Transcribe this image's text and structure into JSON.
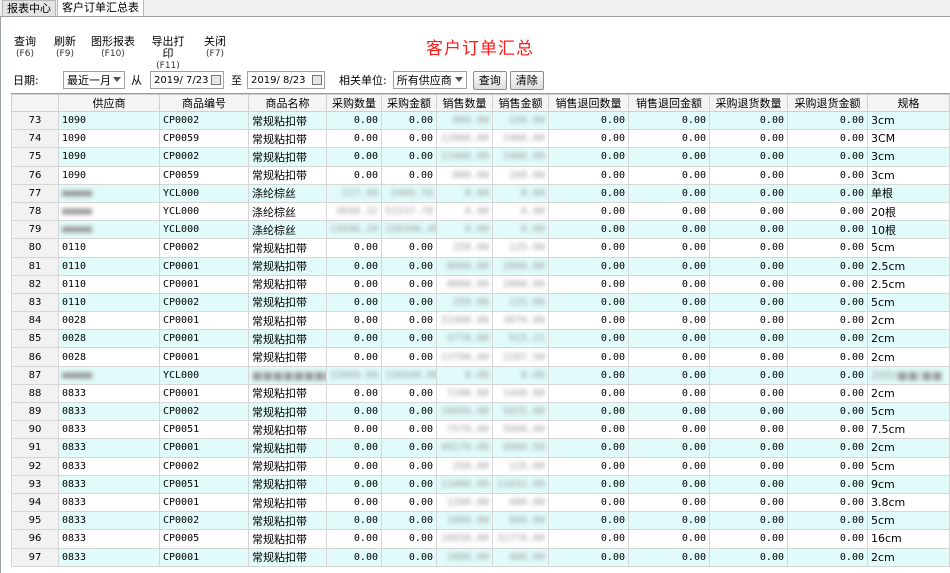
{
  "tabs": [
    {
      "label": "报表中心",
      "active": false
    },
    {
      "label": "客户订单汇总表",
      "active": true
    }
  ],
  "toolbar": {
    "buttons": [
      {
        "label": "查询",
        "key": "(F6)"
      },
      {
        "label": "刷新",
        "key": "(F9)"
      },
      {
        "label": "图形报表",
        "key": "(F10)"
      },
      {
        "label": "导出打印",
        "key": "(F11)"
      },
      {
        "label": "关闭",
        "key": "(F7)"
      }
    ]
  },
  "page_title": "客户订单汇总",
  "filters": {
    "date_label": "日期:",
    "period_value": "最近一月",
    "from_label": "从",
    "date_from": "2019/ 7/23",
    "to_label": "至",
    "date_to": "2019/ 8/23",
    "unit_label": "相关单位:",
    "unit_value": "所有供应商",
    "query_button": "查询",
    "clear_button": "清除"
  },
  "table": {
    "columns": [
      "",
      "供应商",
      "商品编号",
      "商品名称",
      "采购数量",
      "采购金额",
      "销售数量",
      "销售金额",
      "销售退回数量",
      "销售退回金额",
      "采购退货数量",
      "采购退货金额",
      "规格"
    ],
    "rows": [
      [
        "73",
        "1090",
        "CP0002",
        "常规粘扣带",
        "0.00",
        "0.00",
        "800.00",
        "160.00",
        "0.00",
        "0.00",
        "0.00",
        "0.00",
        "3cm"
      ],
      [
        "74",
        "1090",
        "CP0059",
        "常规粘扣带",
        "0.00",
        "0.00",
        "12000.00",
        "2400.00",
        "0.00",
        "0.00",
        "0.00",
        "0.00",
        "3CM"
      ],
      [
        "75",
        "1090",
        "CP0002",
        "常规粘扣带",
        "0.00",
        "0.00",
        "12400.00",
        "2400.00",
        "0.00",
        "0.00",
        "0.00",
        "0.00",
        "3cm"
      ],
      [
        "76",
        "1090",
        "CP0059",
        "常规粘扣带",
        "0.00",
        "0.00",
        "800.00",
        "160.00",
        "0.00",
        "0.00",
        "0.00",
        "0.00",
        "3cm"
      ],
      [
        "77",
        "■■■■■",
        "YCL000",
        "涤纶棕丝",
        "217.40",
        "2409.70",
        "0.00",
        "0.00",
        "0.00",
        "0.00",
        "0.00",
        "0.00",
        "单根"
      ],
      [
        "78",
        "■■■■■",
        "YCL000",
        "涤纶棕丝",
        "4650.32",
        "51537.78",
        "0.00",
        "0.00",
        "0.00",
        "0.00",
        "0.00",
        "0.00",
        "20根"
      ],
      [
        "79",
        "■■■■■",
        "YCL000",
        "涤纶棕丝",
        "13596.20",
        "150396.49",
        "0.00",
        "0.00",
        "0.00",
        "0.00",
        "0.00",
        "0.00",
        "10根"
      ],
      [
        "80",
        "0110",
        "CP0002",
        "常规粘扣带",
        "0.00",
        "0.00",
        "250.00",
        "125.00",
        "0.00",
        "0.00",
        "0.00",
        "0.00",
        "5cm"
      ],
      [
        "81",
        "0110",
        "CP0001",
        "常规粘扣带",
        "0.00",
        "0.00",
        "8000.00",
        "2000.00",
        "0.00",
        "0.00",
        "0.00",
        "0.00",
        "2.5cm"
      ],
      [
        "82",
        "0110",
        "CP0001",
        "常规粘扣带",
        "0.00",
        "0.00",
        "8000.00",
        "2000.00",
        "0.00",
        "0.00",
        "0.00",
        "0.00",
        "2.5cm"
      ],
      [
        "83",
        "0110",
        "CP0002",
        "常规粘扣带",
        "0.00",
        "0.00",
        "250.00",
        "125.00",
        "0.00",
        "0.00",
        "0.00",
        "0.00",
        "5cm"
      ],
      [
        "84",
        "0028",
        "CP0001",
        "常规粘扣带",
        "0.00",
        "0.00",
        "22400.00",
        "3870.00",
        "0.00",
        "0.00",
        "0.00",
        "0.00",
        "2cm"
      ],
      [
        "85",
        "0028",
        "CP0001",
        "常规粘扣带",
        "0.00",
        "0.00",
        "4770.00",
        "915.21",
        "0.00",
        "0.00",
        "0.00",
        "0.00",
        "2cm"
      ],
      [
        "86",
        "0028",
        "CP0001",
        "常规粘扣带",
        "0.00",
        "0.00",
        "13700.00",
        "2207.50",
        "0.00",
        "0.00",
        "0.00",
        "0.00",
        "2cm"
      ],
      [
        "87",
        "■■■■■",
        "YCL000",
        "■■■■■■■■",
        "33960.00",
        "156040.00",
        "0.00",
        "0.00",
        "0.00",
        "0.00",
        "0.00",
        "0.00",
        "20D/■■/■■"
      ],
      [
        "88",
        "0833",
        "CP0001",
        "常规粘扣带",
        "0.00",
        "0.00",
        "7200.00",
        "1440.00",
        "0.00",
        "0.00",
        "0.00",
        "0.00",
        "2cm"
      ],
      [
        "89",
        "0833",
        "CP0002",
        "常规粘扣带",
        "0.00",
        "0.00",
        "10050.00",
        "5025.00",
        "0.00",
        "0.00",
        "0.00",
        "0.00",
        "5cm"
      ],
      [
        "90",
        "0833",
        "CP0051",
        "常规粘扣带",
        "0.00",
        "0.00",
        "7570.00",
        "5660.00",
        "0.00",
        "0.00",
        "0.00",
        "0.00",
        "7.5cm"
      ],
      [
        "91",
        "0833",
        "CP0001",
        "常规粘扣带",
        "0.00",
        "0.00",
        "49170.00",
        "9960.50",
        "0.00",
        "0.00",
        "0.00",
        "0.00",
        "2cm"
      ],
      [
        "92",
        "0833",
        "CP0002",
        "常规粘扣带",
        "0.00",
        "0.00",
        "250.00",
        "125.00",
        "0.00",
        "0.00",
        "0.00",
        "0.00",
        "5cm"
      ],
      [
        "93",
        "0833",
        "CP0051",
        "常规粘扣带",
        "0.00",
        "0.00",
        "11000.00",
        "11032.00",
        "0.00",
        "0.00",
        "0.00",
        "0.00",
        "9cm"
      ],
      [
        "94",
        "0833",
        "CP0001",
        "常规粘扣带",
        "0.00",
        "0.00",
        "1200.00",
        "480.00",
        "0.00",
        "0.00",
        "0.00",
        "0.00",
        "3.8cm"
      ],
      [
        "95",
        "0833",
        "CP0002",
        "常规粘扣带",
        "0.00",
        "0.00",
        "1000.00",
        "500.00",
        "0.00",
        "0.00",
        "0.00",
        "0.00",
        "5cm"
      ],
      [
        "96",
        "0833",
        "CP0005",
        "常规粘扣带",
        "0.00",
        "0.00",
        "16650.00",
        "31779.00",
        "0.00",
        "0.00",
        "0.00",
        "0.00",
        "16cm"
      ],
      [
        "97",
        "0833",
        "CP0001",
        "常规粘扣带",
        "0.00",
        "0.00",
        "2000.00",
        "400.00",
        "0.00",
        "0.00",
        "0.00",
        "0.00",
        "2cm"
      ]
    ],
    "blurred_columns": [
      6,
      7
    ]
  }
}
